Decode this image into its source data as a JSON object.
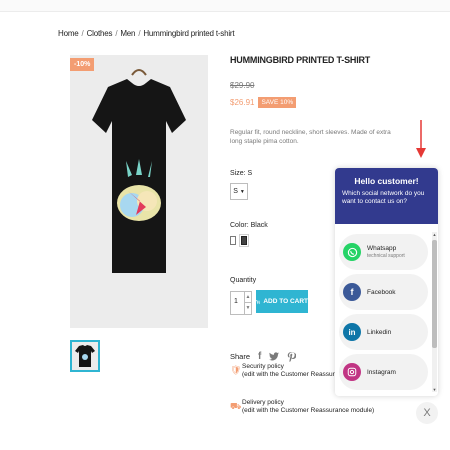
{
  "breadcrumb": {
    "items": [
      "Home",
      "Clothes",
      "Men",
      "Hummingbird printed t-shirt"
    ],
    "separator": "/"
  },
  "product": {
    "discount_flag": "-10%",
    "title": "HUMMINGBIRD PRINTED T-SHIRT",
    "regular_price": "$29.90",
    "price": "$26.91",
    "save_badge": "SAVE 10%",
    "description": "Regular fit, round neckline, short sleeves. Made of extra long staple pima cotton.",
    "size_label": "Size: S",
    "size_value": "S",
    "color_label": "Color: Black",
    "colors": [
      "white",
      "black"
    ],
    "quantity_label": "Quantity",
    "quantity_value": "1",
    "add_to_cart": "ADD TO CART",
    "share_label": "Share"
  },
  "reassurance": [
    {
      "title": "Security policy",
      "sub": "(edit with the Customer Reassurance module)"
    },
    {
      "title": "Delivery policy",
      "sub": "(edit with the Customer Reassurance module)"
    }
  ],
  "chat": {
    "hello": "Hello customer!",
    "question": "Which social network do you want to contact us on?",
    "items": [
      {
        "name": "Whatsapp",
        "sub": "technical support",
        "icon": "whatsapp-icon",
        "color": "#25d366"
      },
      {
        "name": "Facebook",
        "sub": "",
        "icon": "facebook-icon",
        "color": "#3b5998"
      },
      {
        "name": "Linkedin",
        "sub": "",
        "icon": "linkedin-icon",
        "color": "#0e76a8"
      },
      {
        "name": "Instagram",
        "sub": "",
        "icon": "instagram-icon",
        "color": "#c13584"
      }
    ],
    "close_glyph": "X"
  },
  "colors": {
    "accent": "#2fb5d2",
    "sale": "#f39d72",
    "chat_header": "#323a8e",
    "arrow": "#e53935"
  }
}
